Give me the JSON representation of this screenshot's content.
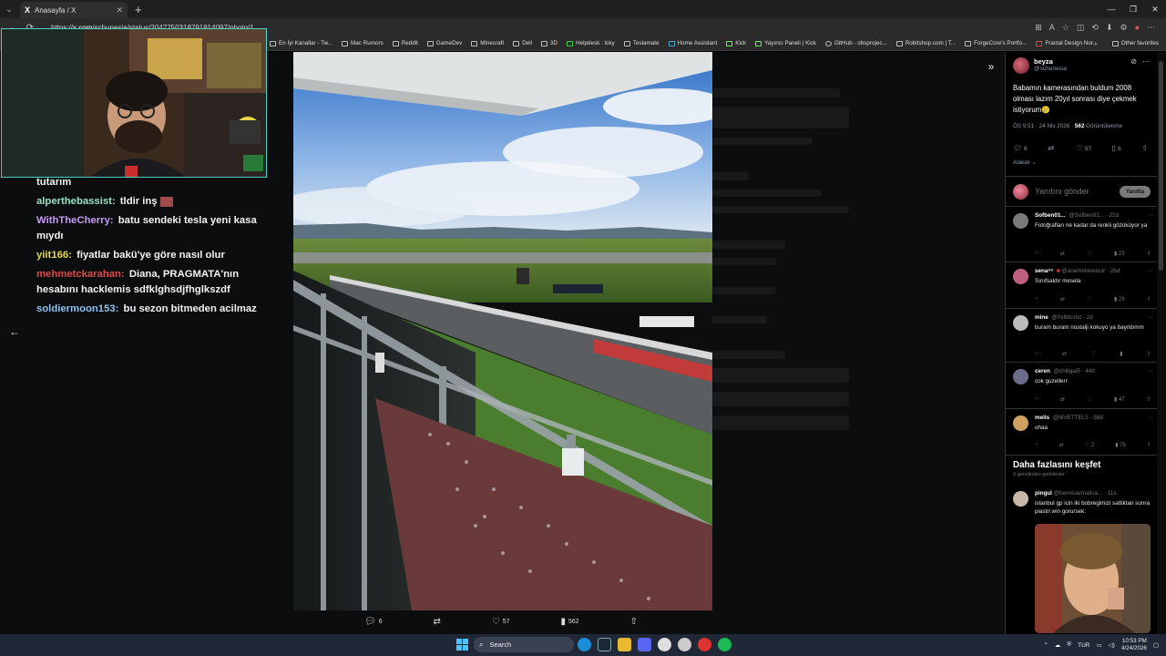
{
  "browser": {
    "tab_title": "Anasayfa / X",
    "tab_logo": "X",
    "url_host": "x.com",
    "url_path": "/schunesia/status/2047750318791814097/photo/1",
    "url_prefix": "https://",
    "bookmarks": [
      "En İyi Kanallar - Tw...",
      "Mac Rumors",
      "Reddit",
      "GameDev",
      "Minecraft",
      "Dell",
      "3D",
      "Helpdesk : loky",
      "Teslamate",
      "Home Assistant",
      "Kick",
      "Yayıncı Paneli | Kick",
      "GitHub - obsprojec...",
      "Robitshop.com | T...",
      "ForgeCore's Portfo...",
      "Fractal Design Nor..."
    ],
    "other_bookmarks": "Other favorites"
  },
  "chat": {
    "messages": [
      {
        "user": "",
        "text": "tutarım",
        "color": "#ffffff"
      },
      {
        "user": "alperthebassist:",
        "text": "tldir inş",
        "color": "#9be0c3"
      },
      {
        "user": "WithTheCherry:",
        "text": "batu sendeki tesla yeni kasa mıydı",
        "color": "#c79bf2"
      },
      {
        "user": "yiit166:",
        "text": "fiyatlar bakü'ye göre nasıl olur",
        "color": "#e6d84a"
      },
      {
        "user": "mehmetckarahan:",
        "text": "Diana, PRAGMATA'nın hesabını hacklemis sdfklghsdjfhglkszdf",
        "color": "#e04a4a"
      },
      {
        "user": "soldiermoon153:",
        "text": "bu sezon bitmeden acilmaz",
        "color": "#8fc3f2"
      }
    ]
  },
  "photo_actions": {
    "replies": "6",
    "likes": "57",
    "views": "562"
  },
  "tweet": {
    "author_name": "beyza",
    "author_handle": "@schunesia",
    "text": "Babamın kamerasından buldum 2008 olması lazım 20yıl sonrası diye çekmek istiyorum🥲",
    "time": "ÖS 9:51 · 24 Nis 2026 · ",
    "views_count": "562",
    "views_label": "Görüntülenme",
    "replies": "6",
    "likes": "57",
    "bookmarks": "6",
    "relevance_label": "Alakalı",
    "reply_placeholder": "Yanıtını gönder",
    "reply_button": "Yanıtla"
  },
  "replies": [
    {
      "name": "Sofben01...",
      "handle": "@Sofben01...",
      "time": "· 22d",
      "text": "Fotoğrafları ne kadar da renkli gözüküyor ya",
      "views": "23",
      "likes": "",
      "color": "#8a8a8a"
    },
    {
      "name": "sena⁶⁶",
      "handle": "@anemolavenoir",
      "time": "· 26d",
      "text": "Sınıfsaldır mesela",
      "views": "29",
      "likes": "",
      "color": "#c06080"
    },
    {
      "name": "mine",
      "handle": "@0xlbtsvtxt",
      "time": "· 2d",
      "text": "buram buram nostalji kokuyo ya bayıldımm",
      "views": "",
      "likes": "",
      "color": "#bbbbbb"
    },
    {
      "name": "ceren",
      "handle": "@chillgal5",
      "time": "· 44d",
      "text": "cok guzellerr",
      "views": "47",
      "likes": "",
      "color": "#6a6a8a"
    },
    {
      "name": "melis",
      "handle": "@MVETTEL5",
      "time": "· 58d",
      "text": "ohaa",
      "views": "76",
      "likes": "2",
      "color": "#d0a060"
    }
  ],
  "discover": {
    "title": "Daha fazlasını keşfet",
    "subtitle": "X genelinden getirilenler",
    "post": {
      "name": "pingul",
      "handle": "@bennsacmalica...",
      "time": "· 11s",
      "text": "istanbul gp icin iki bobregimizi sattiktan sonra piastri win gorursek:"
    }
  },
  "taskbar": {
    "search_label": "Search",
    "language": "TUR",
    "time": "10:53 PM",
    "date": "4/24/2026"
  }
}
